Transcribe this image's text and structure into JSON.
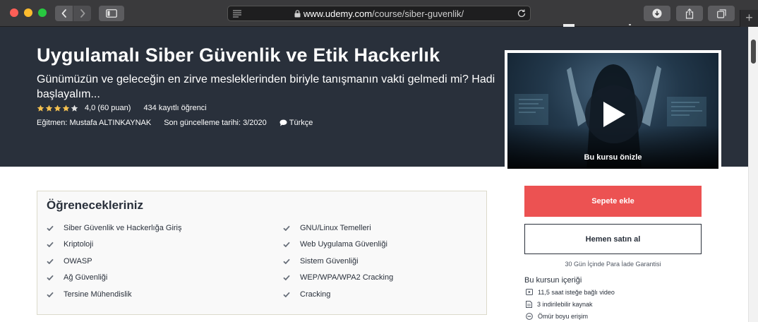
{
  "browser": {
    "url_host": "www.udemy.com",
    "url_path": "/course/siber-guvenlik/",
    "new_tab_label": "+"
  },
  "course": {
    "title": "Uygulamalı Siber Güvenlik ve Etik Hackerlık",
    "subtitle": "Günümüzün ve geleceğin en zirve mesleklerinden biriyle tanışmanın vakti gelmedi mi? Hadi başlayalım...",
    "rating_value": 4.0,
    "rating_max": 5,
    "rating_text": "4,0 (60 puan)",
    "students_text": "434 kayıtlı öğrenci",
    "instructor_text": "Eğitmen: Mustafa ALTINKAYNAK",
    "updated_text": "Son güncelleme tarihi: 3/2020",
    "language": "Türkçe"
  },
  "preview": {
    "label": "Bu kursu önizle",
    "icon": "play-icon"
  },
  "learn": {
    "title": "Öğrenecekleriniz",
    "col1": [
      "Siber Güvenlik ve Hackerlığa Giriş",
      "Kriptoloji",
      "OWASP",
      "Ağ Güvenliği",
      "Tersine Mühendislik"
    ],
    "col2": [
      "GNU/Linux Temelleri",
      "Web Uygulama Güvenliği",
      "Sistem Güvenliği",
      "WEP/WPA/WPA2 Cracking",
      "Cracking"
    ]
  },
  "purchase": {
    "add_to_cart": "Sepete ekle",
    "buy_now": "Hemen satın al",
    "guarantee": "30 Gün İçinde Para İade Garantisi",
    "includes_title": "Bu kursun içeriği",
    "includes": [
      {
        "icon": "video-icon",
        "text": "11,5 saat isteğe bağlı video"
      },
      {
        "icon": "file-icon",
        "text": "3 indirilebilir kaynak"
      },
      {
        "icon": "infinity-icon",
        "text": "Ömür boyu erişim"
      }
    ]
  },
  "colors": {
    "header_bg": "#29303b",
    "cart_button": "#ec5252",
    "star": "#f4c150"
  }
}
